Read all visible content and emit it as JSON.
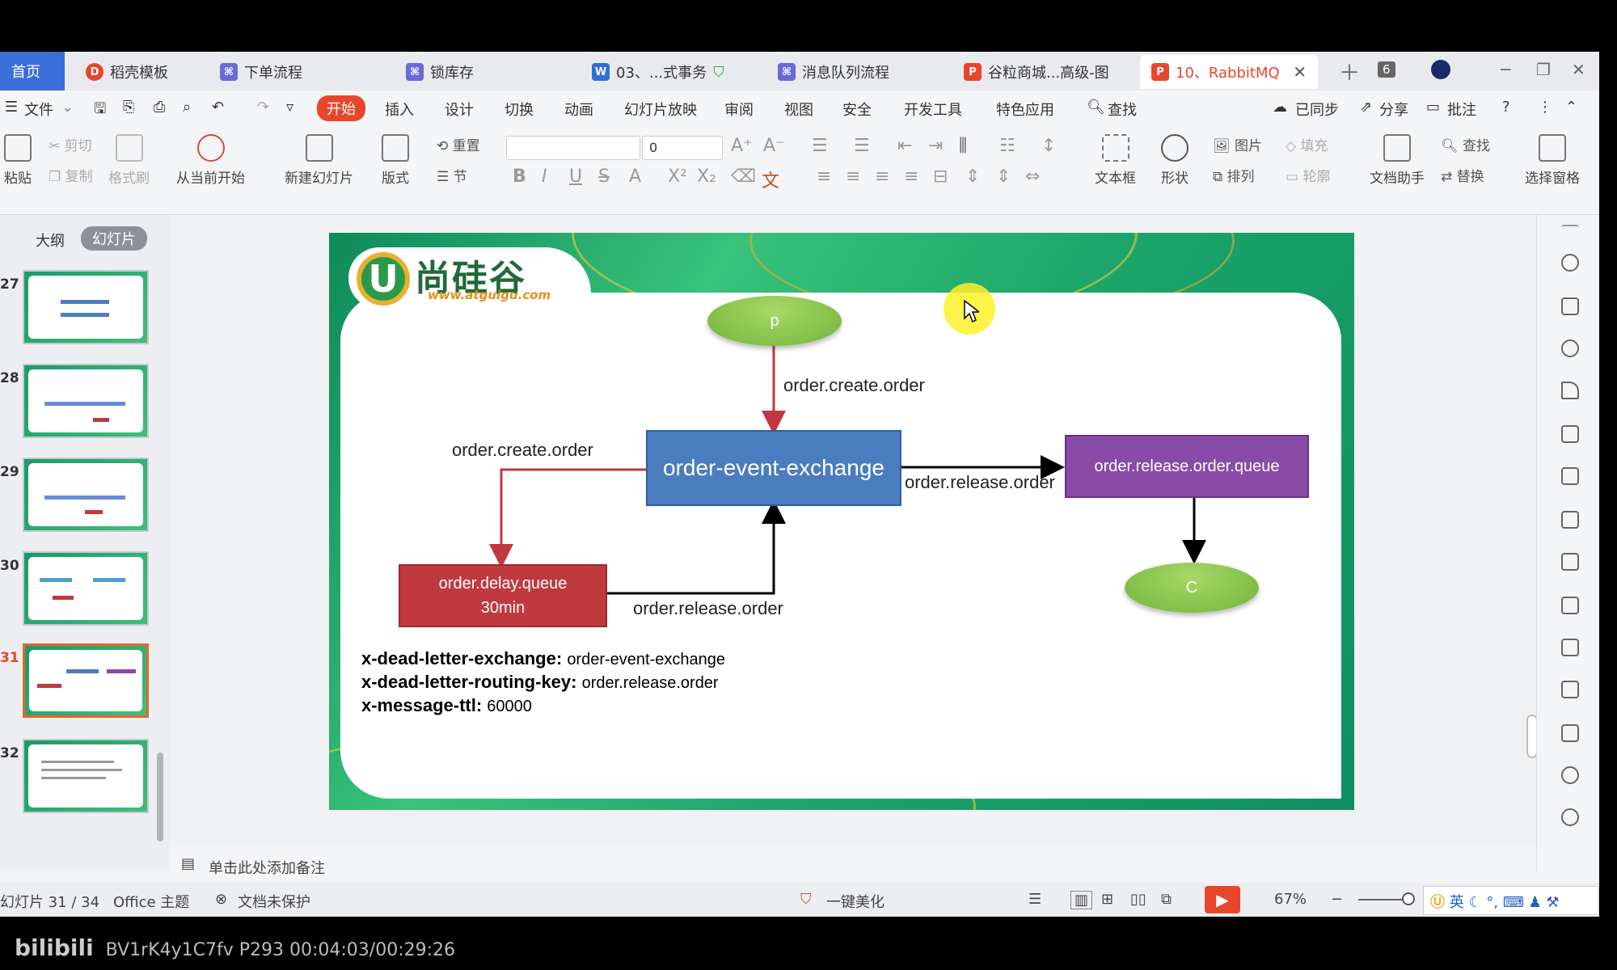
{
  "tabs": [
    {
      "label": "首页",
      "kind": "home"
    },
    {
      "label": "稻壳模板",
      "icon": "docer-icon",
      "icon_color": "#e8462c"
    },
    {
      "label": "下单流程",
      "icon": "flowchart-icon",
      "icon_color": "#6a6ad8"
    },
    {
      "label": "锁库存",
      "icon": "flowchart-icon",
      "icon_color": "#6a6ad8"
    },
    {
      "label": "03、...式事务",
      "icon": "word-icon",
      "icon_color": "#2f6fd8"
    },
    {
      "label": "消息队列流程",
      "icon": "flowchart-icon",
      "icon_color": "#6a6ad8"
    },
    {
      "label": "谷粒商城...高级-图",
      "icon": "ppt-icon",
      "icon_color": "#e8462c"
    },
    {
      "label": "10、RabbitMQ",
      "icon": "ppt-icon",
      "icon_color": "#e8462c",
      "active": true
    }
  ],
  "tab_count": "6",
  "menu": {
    "file": "文件",
    "items": [
      "开始",
      "插入",
      "设计",
      "切换",
      "动画",
      "幻灯片放映",
      "审阅",
      "视图",
      "安全",
      "开发工具",
      "特色应用"
    ],
    "search": "查找",
    "sync": "已同步",
    "share": "分享",
    "comment": "批注"
  },
  "ribbon": {
    "paste": "粘贴",
    "cut": "剪切",
    "copy": "复制",
    "format_painter": "格式刷",
    "play_from_current": "从当前开始",
    "new_slide": "新建幻灯片",
    "layout": "版式",
    "reset": "重置",
    "section": "节",
    "font_size": "0",
    "textbox": "文本框",
    "shape": "形状",
    "picture": "图片",
    "arrange": "排列",
    "fill": "填充",
    "outline": "轮廓",
    "doc_assistant": "文档助手",
    "find": "查找",
    "replace": "替换",
    "select_pane": "选择窗格"
  },
  "panel": {
    "outline_tab": "大纲",
    "slides_tab": "幻灯片",
    "slides": [
      {
        "num": "27"
      },
      {
        "num": "28"
      },
      {
        "num": "29"
      },
      {
        "num": "30"
      },
      {
        "num": "31",
        "current": true
      },
      {
        "num": "32"
      }
    ]
  },
  "slide": {
    "logo_name": "尚硅谷",
    "logo_url": "www.atguigu.com",
    "producer": "p",
    "consumer": "C",
    "exchange": "order-event-exchange",
    "release_queue": "order.release.order.queue",
    "delay_queue_line1": "order.delay.queue",
    "delay_queue_line2": "30min",
    "edge_p_to_exchange": "order.create.order",
    "edge_exchange_to_delay": "order.create.order",
    "edge_exchange_to_release": "order.release.order",
    "edge_delay_to_exchange": "order.release.order",
    "props": [
      {
        "key": "x-dead-letter-exchange:",
        "value": "order-event-exchange"
      },
      {
        "key": "x-dead-letter-routing-key:",
        "value": "order.release.order"
      },
      {
        "key": "x-message-ttl:",
        "value": "60000"
      }
    ],
    "colors": {
      "exchange": "#4a7cc0",
      "release_queue": "#8a4aa8",
      "delay_queue": "#c0393e",
      "ellipse": "#86c34a"
    }
  },
  "notes_placeholder": "单击此处添加备注",
  "status": {
    "slide_pos": "幻灯片 31 / 34",
    "theme": "Office 主题",
    "protect": "文档未保护",
    "beautify": "一键美化",
    "zoom": "67%"
  },
  "ime": "英",
  "bili": {
    "logo": "bilibili",
    "info": "BV1rK4y1C7fv P293 00:04:03/00:29:26"
  }
}
